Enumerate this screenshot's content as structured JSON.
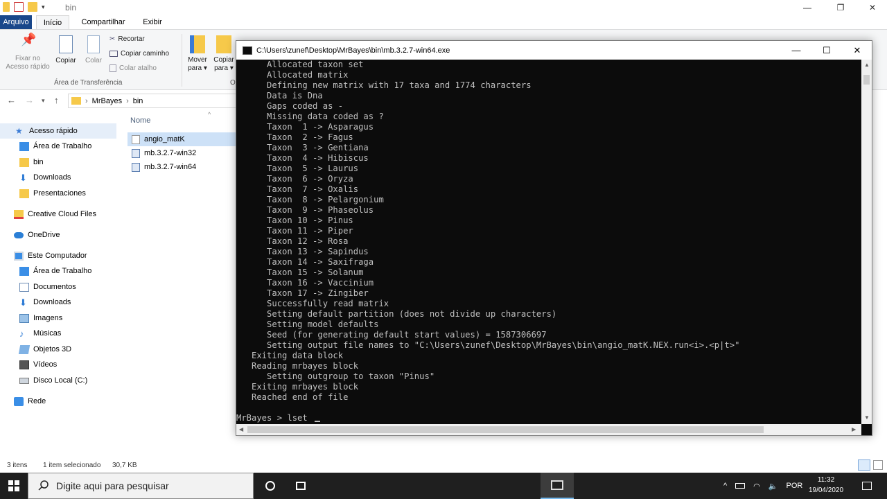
{
  "explorer": {
    "title": "bin",
    "tabs": {
      "file": "Arquivo",
      "home": "Início",
      "share": "Compartilhar",
      "view": "Exibir"
    },
    "ribbon": {
      "pin_label_1": "Fixar no",
      "pin_label_2": "Acesso rápido",
      "copy": "Copiar",
      "paste": "Colar",
      "cut": "Recortar",
      "copy_path": "Copiar caminho",
      "paste_shortcut": "Colar atalho",
      "clipboard_group": "Área de Transferência",
      "move_to_1": "Mover",
      "move_to_2": "para",
      "copy_to_1": "Copiar",
      "copy_to_2": "para",
      "organize_group": "O"
    },
    "breadcrumb": {
      "root": "MrBayes",
      "current": "bin"
    },
    "sidebar": [
      {
        "label": "Acesso rápido",
        "icon": "star-icon"
      },
      {
        "label": "Área de Trabalho",
        "icon": "desktop-icon"
      },
      {
        "label": "bin",
        "icon": "folder-icon"
      },
      {
        "label": "Downloads",
        "icon": "download-icon"
      },
      {
        "label": "Presentaciones",
        "icon": "folder-icon"
      },
      {
        "label": "Creative Cloud Files",
        "icon": "creative-cloud-icon"
      },
      {
        "label": "OneDrive",
        "icon": "onedrive-icon"
      },
      {
        "label": "Este Computador",
        "icon": "computer-icon"
      },
      {
        "label": "Área de Trabalho",
        "icon": "desktop-icon"
      },
      {
        "label": "Documentos",
        "icon": "documents-icon"
      },
      {
        "label": "Downloads",
        "icon": "download-icon"
      },
      {
        "label": "Imagens",
        "icon": "pictures-icon"
      },
      {
        "label": "Músicas",
        "icon": "music-icon"
      },
      {
        "label": "Objetos 3D",
        "icon": "objects-3d-icon"
      },
      {
        "label": "Vídeos",
        "icon": "videos-icon"
      },
      {
        "label": "Disco Local (C:)",
        "icon": "drive-icon"
      },
      {
        "label": "Rede",
        "icon": "network-icon"
      }
    ],
    "column_name": "Nome",
    "files": [
      {
        "name": "angio_matK",
        "type": "file",
        "selected": true
      },
      {
        "name": "mb.3.2.7-win32",
        "type": "exe",
        "selected": false
      },
      {
        "name": "mb.3.2.7-win64",
        "type": "exe",
        "selected": false
      }
    ],
    "status": {
      "items": "3 itens",
      "selection": "1 item selecionado",
      "size": "30,7 KB"
    }
  },
  "console": {
    "title": "C:\\Users\\zunef\\Desktop\\MrBayes\\bin\\mb.3.2.7-win64.exe",
    "lines": [
      "      Allocated taxon set",
      "      Allocated matrix",
      "      Defining new matrix with 17 taxa and 1774 characters",
      "      Data is Dna",
      "      Gaps coded as -",
      "      Missing data coded as ?",
      "      Taxon  1 -> Asparagus",
      "      Taxon  2 -> Fagus",
      "      Taxon  3 -> Gentiana",
      "      Taxon  4 -> Hibiscus",
      "      Taxon  5 -> Laurus",
      "      Taxon  6 -> Oryza",
      "      Taxon  7 -> Oxalis",
      "      Taxon  8 -> Pelargonium",
      "      Taxon  9 -> Phaseolus",
      "      Taxon 10 -> Pinus",
      "      Taxon 11 -> Piper",
      "      Taxon 12 -> Rosa",
      "      Taxon 13 -> Sapindus",
      "      Taxon 14 -> Saxifraga",
      "      Taxon 15 -> Solanum",
      "      Taxon 16 -> Vaccinium",
      "      Taxon 17 -> Zingiber",
      "      Successfully read matrix",
      "      Setting default partition (does not divide up characters)",
      "      Setting model defaults",
      "      Seed (for generating default start values) = 1587306697",
      "      Setting output file names to \"C:\\Users\\zunef\\Desktop\\MrBayes\\bin\\angio_matK.NEX.run<i>.<p|t>\"",
      "   Exiting data block",
      "   Reading mrbayes block",
      "      Setting outgroup to taxon \"Pinus\"",
      "   Exiting mrbayes block",
      "   Reached end of file",
      "",
      "MrBayes > lset "
    ]
  },
  "taskbar": {
    "search_placeholder": "Digite aqui para pesquisar",
    "language": "POR",
    "time": "11:32",
    "date": "19/04/2020"
  }
}
